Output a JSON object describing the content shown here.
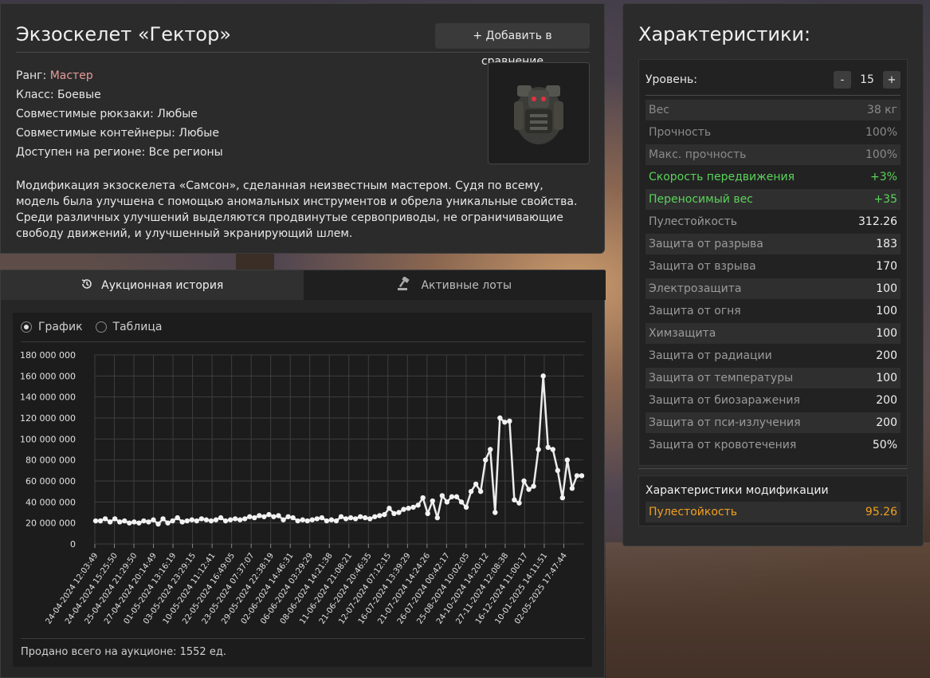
{
  "item": {
    "title": "Экзоскелет «Гектор»",
    "compare_label": "Добавить в сравнение",
    "rank_label": "Ранг:",
    "rank_value": "Мастер",
    "class_line": "Класс: Боевые",
    "backpacks_line": "Совместимые рюкзаки: Любые",
    "containers_line": "Совместимые контейнеры: Любые",
    "region_line": "Доступен на регионе: Все регионы",
    "description": "Модификация экзоскелета «Самсон», сделанная неизвестным мастером. Судя по всему, модель была улучшена с помощью аномальных инструментов и обрела уникальные свойства. Среди различных улучшений выделяются продвинутые сервоприводы, не ограничивающие свободу движений, и улучшенный экранирующий шлем."
  },
  "auction": {
    "tabs": [
      "Аукционная история",
      "Активные лоты"
    ],
    "radio_chart": "График",
    "radio_table": "Таблица",
    "sold_total": "Продано всего на аукционе: 1552 ед."
  },
  "chart_data": {
    "type": "line",
    "y_ticks": [
      "180 000 000",
      "160 000 000",
      "140 000 000",
      "120 000 000",
      "100 000 000",
      "80 000 000",
      "60 000 000",
      "40 000 000",
      "20 000 000",
      "0"
    ],
    "ylim": [
      0,
      180000000
    ],
    "grid": true,
    "x_tick_labels": [
      "24-04-2024 12:03:49",
      "24-04-2024 15:25:50",
      "25-04-2024 21:29:50",
      "27-04-2024 20:14:49",
      "01-05-2024 13:16:19",
      "03-05-2024 23:29:15",
      "10-05-2024 11:12:41",
      "22-05-2024 16:49:05",
      "23-05-2024 07:37:07",
      "29-05-2024 22:38:19",
      "02-06-2024 14:46:31",
      "06-06-2024 03:29:29",
      "08-06-2024 14:21:38",
      "11-06-2024 21:08:21",
      "21-06-2024 20:46:35",
      "12-07-2024 07:12:15",
      "16-07-2024 13:39:29",
      "21-07-2024 14:24:26",
      "26-07-2024 00:42:17",
      "25-08-2024 10:02:05",
      "24-10-2024 14:20:12",
      "27-11-2024 12:08:38",
      "16-12-2024 11:00:17",
      "10-01-2025 14:11:51",
      "02-05-2025 17:47:44"
    ],
    "values": [
      22000000,
      22000000,
      24000000,
      21000000,
      24000000,
      21000000,
      22000000,
      20000000,
      21000000,
      20000000,
      22000000,
      21000000,
      23000000,
      19000000,
      24000000,
      20000000,
      22000000,
      25000000,
      21000000,
      22000000,
      23000000,
      22000000,
      24000000,
      23000000,
      22000000,
      23000000,
      25000000,
      22000000,
      23000000,
      24000000,
      23000000,
      24000000,
      26000000,
      25000000,
      27000000,
      26000000,
      28000000,
      26000000,
      27000000,
      23000000,
      26000000,
      25000000,
      22000000,
      23000000,
      22000000,
      23000000,
      24000000,
      25000000,
      22000000,
      23000000,
      22000000,
      26000000,
      24000000,
      25000000,
      24000000,
      26000000,
      25000000,
      24000000,
      26000000,
      27000000,
      28000000,
      34000000,
      29000000,
      30000000,
      33000000,
      34000000,
      35000000,
      37000000,
      44000000,
      29000000,
      41000000,
      25000000,
      46000000,
      40000000,
      45000000,
      45000000,
      40000000,
      35000000,
      50000000,
      57000000,
      50000000,
      80000000,
      90000000,
      30000000,
      120000000,
      116000000,
      117000000,
      42000000,
      39000000,
      60000000,
      52000000,
      55000000,
      90000000,
      160000000,
      92000000,
      90000000,
      70000000,
      44000000,
      80000000,
      53000000,
      65000000,
      65000000
    ]
  },
  "stats": {
    "title": "Характеристики:",
    "level_label": "Уровень:",
    "level_value": "15",
    "minus": "-",
    "plus": "+",
    "rows": [
      {
        "name": "Вес",
        "value": "38 кг",
        "style": "muted"
      },
      {
        "name": "Прочность",
        "value": "100%",
        "style": "muted"
      },
      {
        "name": "Макс. прочность",
        "value": "100%",
        "style": "muted"
      },
      {
        "name": "Скорость передвижения",
        "value": "+3%",
        "style": "green"
      },
      {
        "name": "Переносимый вес",
        "value": "+35",
        "style": "green"
      },
      {
        "name": "Пулестойкость",
        "value": "312.26",
        "style": "white"
      },
      {
        "name": "Защита от разрыва",
        "value": "183",
        "style": "white"
      },
      {
        "name": "Защита от взрыва",
        "value": "170",
        "style": "white"
      },
      {
        "name": "Электрозащита",
        "value": "100",
        "style": "white"
      },
      {
        "name": "Защита от огня",
        "value": "100",
        "style": "white"
      },
      {
        "name": "Химзащита",
        "value": "100",
        "style": "white"
      },
      {
        "name": "Защита от радиации",
        "value": "200",
        "style": "white"
      },
      {
        "name": "Защита от температуры",
        "value": "100",
        "style": "white"
      },
      {
        "name": "Защита от биозаражения",
        "value": "200",
        "style": "white"
      },
      {
        "name": "Защита от пси-излучения",
        "value": "200",
        "style": "white"
      },
      {
        "name": "Защита от кровотечения",
        "value": "50%",
        "style": "white"
      }
    ],
    "mod_title": "Характеристики модификации",
    "mod_row": {
      "name": "Пулестойкость",
      "value": "95.26"
    }
  }
}
